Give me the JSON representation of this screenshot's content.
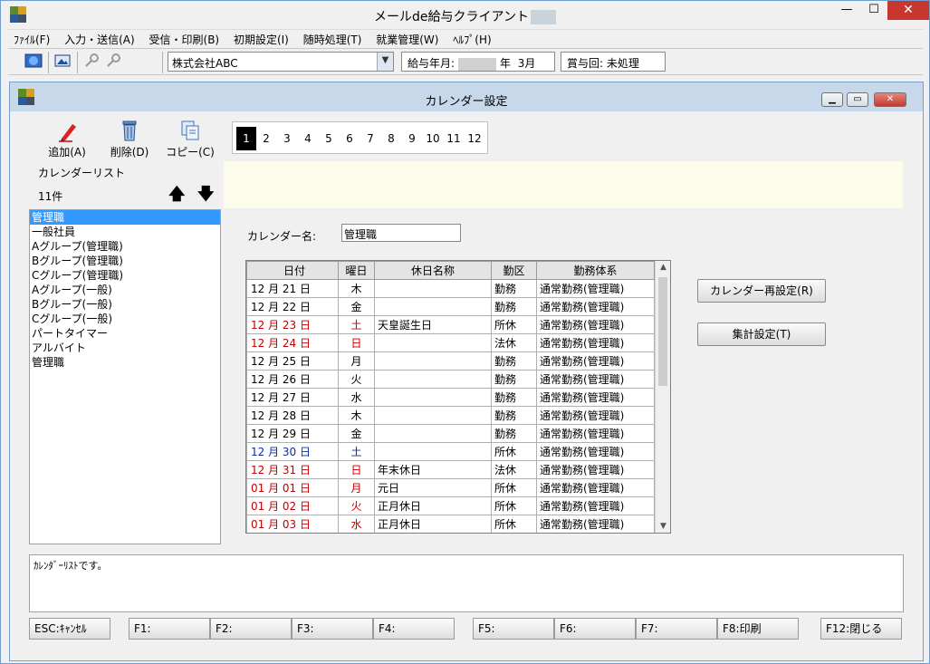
{
  "app": {
    "title": "メールde給与クライアント"
  },
  "menu": [
    "ﾌｧｲﾙ(F)",
    "入力・送信(A)",
    "受信・印刷(B)",
    "初期設定(I)",
    "随時処理(T)",
    "就業管理(W)",
    "ﾍﾙﾌﾟ(H)"
  ],
  "toolbar": {
    "company": "株式会社ABC",
    "pay_label": "給与年月:",
    "pay_year_suffix": "年",
    "pay_month": "3月",
    "bonus": "賞与回: 未処理"
  },
  "dialog": {
    "title": "カレンダー設定",
    "actions": {
      "add": "追加(A)",
      "delete": "削除(D)",
      "copy": "コピー(C)"
    },
    "months": [
      "1",
      "2",
      "3",
      "4",
      "5",
      "6",
      "7",
      "8",
      "9",
      "10",
      "11",
      "12"
    ],
    "list_title": "カレンダーリスト",
    "list_count": "11件",
    "list_items": [
      "管理職",
      "一般社員",
      "Aグループ(管理職)",
      "Bグループ(管理職)",
      "Cグループ(管理職)",
      "Aグループ(一般)",
      "Bグループ(一般)",
      "Cグループ(一般)",
      "パートタイマー",
      "アルバイト",
      "管理職"
    ],
    "calendar_name_label": "カレンダー名:",
    "calendar_name_value": "管理職",
    "columns": [
      "日付",
      "曜日",
      "休日名称",
      "勤区",
      "勤務体系"
    ],
    "rows": [
      {
        "date": "12 月 21 日",
        "dow": "木",
        "holiday": "",
        "kin": "勤務",
        "system": "通常勤務(管理職)",
        "color": "black"
      },
      {
        "date": "12 月 22 日",
        "dow": "金",
        "holiday": "",
        "kin": "勤務",
        "system": "通常勤務(管理職)",
        "color": "black"
      },
      {
        "date": "12 月 23 日",
        "dow": "土",
        "holiday": "天皇誕生日",
        "kin": "所休",
        "system": "通常勤務(管理職)",
        "color": "red"
      },
      {
        "date": "12 月 24 日",
        "dow": "日",
        "holiday": "",
        "kin": "法休",
        "system": "通常勤務(管理職)",
        "color": "red"
      },
      {
        "date": "12 月 25 日",
        "dow": "月",
        "holiday": "",
        "kin": "勤務",
        "system": "通常勤務(管理職)",
        "color": "black"
      },
      {
        "date": "12 月 26 日",
        "dow": "火",
        "holiday": "",
        "kin": "勤務",
        "system": "通常勤務(管理職)",
        "color": "black"
      },
      {
        "date": "12 月 27 日",
        "dow": "水",
        "holiday": "",
        "kin": "勤務",
        "system": "通常勤務(管理職)",
        "color": "black"
      },
      {
        "date": "12 月 28 日",
        "dow": "木",
        "holiday": "",
        "kin": "勤務",
        "system": "通常勤務(管理職)",
        "color": "black"
      },
      {
        "date": "12 月 29 日",
        "dow": "金",
        "holiday": "",
        "kin": "勤務",
        "system": "通常勤務(管理職)",
        "color": "black"
      },
      {
        "date": "12 月 30 日",
        "dow": "土",
        "holiday": "",
        "kin": "所休",
        "system": "通常勤務(管理職)",
        "color": "blue"
      },
      {
        "date": "12 月 31 日",
        "dow": "日",
        "holiday": "年末休日",
        "kin": "法休",
        "system": "通常勤務(管理職)",
        "color": "red"
      },
      {
        "date": "01 月 01 日",
        "dow": "月",
        "holiday": "元日",
        "kin": "所休",
        "system": "通常勤務(管理職)",
        "color": "red"
      },
      {
        "date": "01 月 02 日",
        "dow": "火",
        "holiday": "正月休日",
        "kin": "所休",
        "system": "通常勤務(管理職)",
        "color": "red"
      },
      {
        "date": "01 月 03 日",
        "dow": "水",
        "holiday": "正月休日",
        "kin": "所休",
        "system": "通常勤務(管理職)",
        "color": "red"
      }
    ],
    "reset_button": "カレンダー再設定(R)",
    "summary_button": "集計設定(T)",
    "status_text": "ｶﾚﾝﾀﾞｰﾘｽﾄです。"
  },
  "fkeys": [
    "ESC:ｷｬﾝｾﾙ",
    "F1:",
    "F2:",
    "F3:",
    "F4:",
    "F5:",
    "F6:",
    "F7:",
    "F8:印刷",
    "F12:閉じる"
  ]
}
